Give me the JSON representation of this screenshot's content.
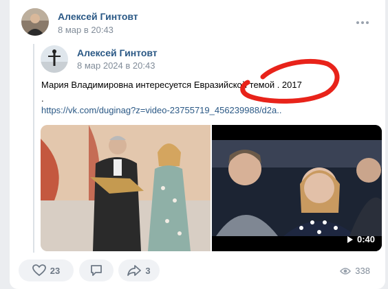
{
  "post": {
    "author": "Алексей Гинтовт",
    "time": "8 мар в 20:43"
  },
  "repost": {
    "author": "Алексей Гинтовт",
    "time": "8 мар 2024 в 20:43",
    "text": "Мария Владимировна интересуется Евразийской темой . 2017",
    "dot": ".",
    "link": "https://vk.com/duginag?z=video-23755719_456239988/d2a.."
  },
  "attachments": {
    "video_duration": "0:40"
  },
  "actions": {
    "likes": "23",
    "reposts": "3",
    "views": "338"
  },
  "icons": {
    "like": "heart-icon",
    "comment": "comment-icon",
    "share": "share-icon",
    "views": "eye-icon",
    "more": "more-icon",
    "play": "play-icon"
  },
  "colors": {
    "name": "#2a5885",
    "link": "#2a5885",
    "meta": "#818c99",
    "annotation": "#e8231a"
  }
}
